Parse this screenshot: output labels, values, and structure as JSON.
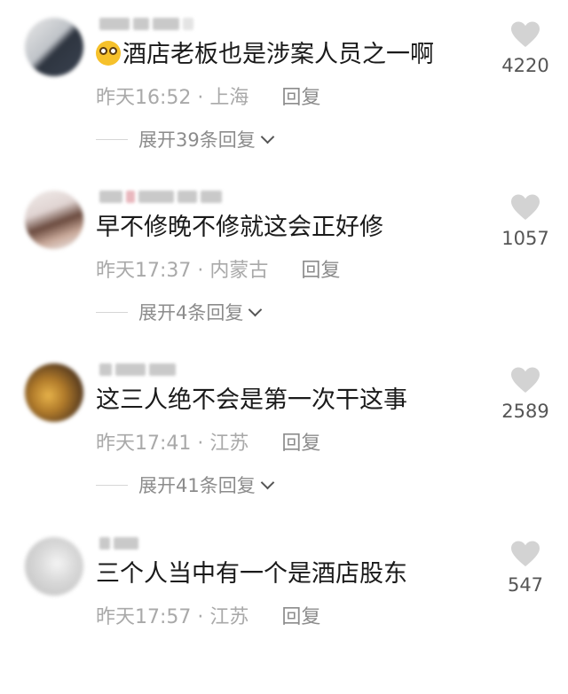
{
  "comments": [
    {
      "text": "酒店老板也是涉案人员之一啊",
      "time": "昨天16:52",
      "location": "· 上海",
      "reply": "回复",
      "expand": "展开39条回复",
      "likes": "4220"
    },
    {
      "text": "早不修晚不修就这会正好修",
      "time": "昨天17:37",
      "location": "· 内蒙古",
      "reply": "回复",
      "expand": "展开4条回复",
      "likes": "1057"
    },
    {
      "text": "这三人绝不会是第一次干这事",
      "time": "昨天17:41",
      "location": "· 江苏",
      "reply": "回复",
      "expand": "展开41条回复",
      "likes": "2589"
    },
    {
      "text": "三个人当中有一个是酒店股东",
      "time": "昨天17:57",
      "location": "· 江苏",
      "reply": "回复",
      "expand": "",
      "likes": "547"
    }
  ],
  "colors": {
    "text": "#1a1a1a",
    "meta": "#a9a9a9",
    "heart": "#d3d3d3"
  }
}
